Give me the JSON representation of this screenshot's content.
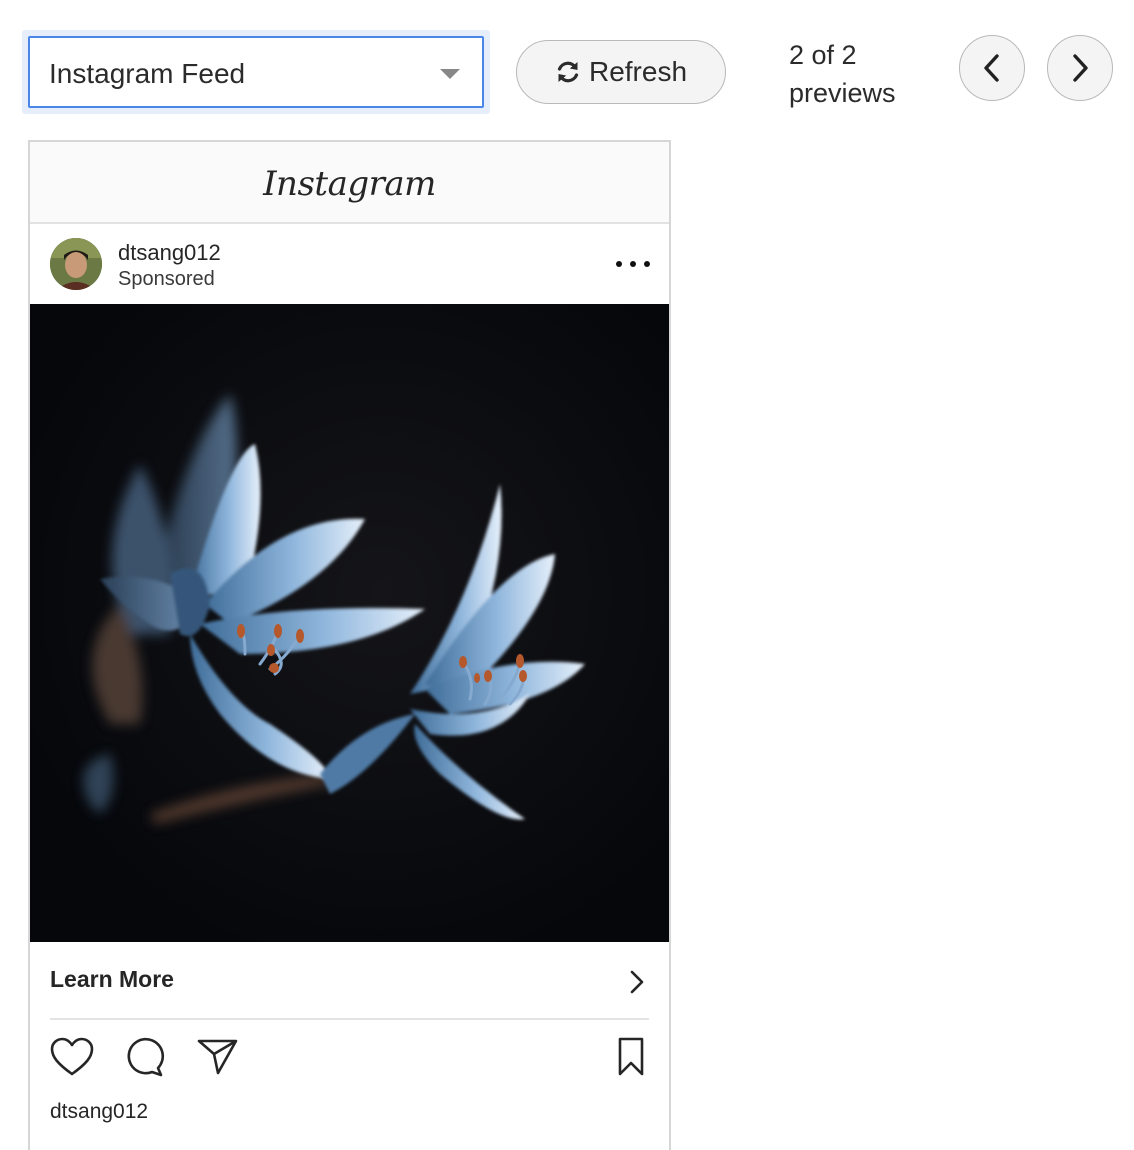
{
  "toolbar": {
    "format_select": {
      "value": "Instagram Feed"
    },
    "refresh_label": "Refresh",
    "counter_line1": "2 of 2",
    "counter_line2": "previews"
  },
  "preview": {
    "platform_logo": "Instagram",
    "account": {
      "username": "dtsang012",
      "subtitle": "Sponsored"
    },
    "cta_label": "Learn More",
    "caption_username": "dtsang012"
  },
  "icons": {
    "refresh": "refresh-icon",
    "prev": "chevron-left-icon",
    "next": "chevron-right-icon",
    "more": "more-options-icon",
    "like": "heart-icon",
    "comment": "comment-bubble-icon",
    "share": "paper-plane-icon",
    "save": "bookmark-icon"
  },
  "colors": {
    "select_focus_border": "#4a86e8",
    "select_focus_halo": "#e6eefb",
    "image_background": "#07090d",
    "petal_blue": "#8fb6dc"
  }
}
